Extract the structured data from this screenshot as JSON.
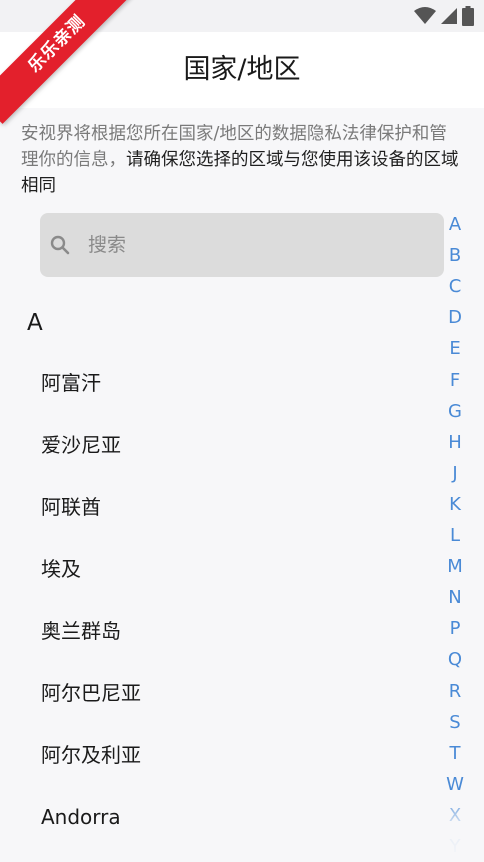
{
  "watermark": {
    "text": "乐乐亲测"
  },
  "app_bar": {
    "title": "国家/地区",
    "back_icon": "arrow-left-icon"
  },
  "notice": {
    "muted_text": "安视界将根据您所在国家/地区的数据隐私法律保护和管理你的信息，",
    "main_text": "请确保您选择的区域与您使用该设备的区域相同"
  },
  "search": {
    "placeholder": "搜索",
    "icon": "search-icon"
  },
  "list": {
    "section": "A",
    "countries": [
      "阿富汗",
      "爱沙尼亚",
      "阿联酋",
      "埃及",
      "奥兰群岛",
      "阿尔巴尼亚",
      "阿尔及利亚",
      "Andorra"
    ]
  },
  "index_letters": [
    "A",
    "B",
    "C",
    "D",
    "E",
    "F",
    "G",
    "H",
    "J",
    "K",
    "L",
    "M",
    "N",
    "P",
    "Q",
    "R",
    "S",
    "T",
    "W",
    "X",
    "Y"
  ],
  "colors": {
    "accent": "#4a8ad6",
    "watermark": "#e3202c",
    "search_bg": "#dcdcdc"
  }
}
